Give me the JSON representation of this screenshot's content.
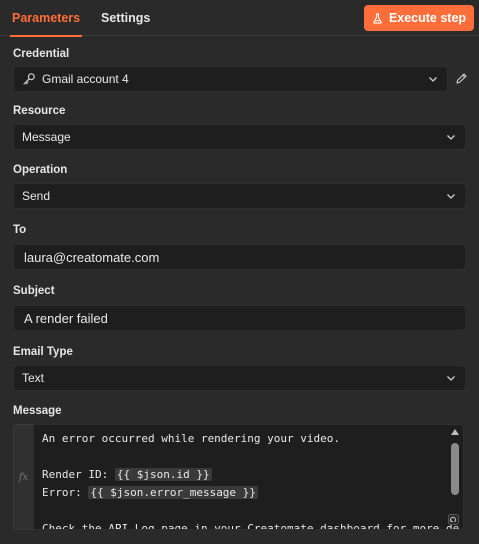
{
  "tabs": [
    {
      "label": "Parameters",
      "active": true
    },
    {
      "label": "Settings",
      "active": false
    }
  ],
  "execute_button": {
    "label": "Execute step",
    "icon": "flask-icon"
  },
  "accent_color": "#ff6d3a",
  "credential": {
    "label": "Credential",
    "value": "Gmail account 4"
  },
  "resource": {
    "label": "Resource",
    "value": "Message"
  },
  "operation": {
    "label": "Operation",
    "value": "Send"
  },
  "to": {
    "label": "To",
    "value": "laura@creatomate.com"
  },
  "subject": {
    "label": "Subject",
    "value": "A render failed"
  },
  "email_type": {
    "label": "Email Type",
    "value": "Text"
  },
  "message": {
    "label": "Message",
    "gutter": "fx",
    "line1": "An error occurred while rendering your video.",
    "line3_prefix": "Render ID: ",
    "line3_expr": "{{ $json.id }}",
    "line4_prefix": "Error: ",
    "line4_expr": "{{ $json.error_message }}",
    "line6": "Check the API Log page in your Creatomate dashboard for more de"
  }
}
